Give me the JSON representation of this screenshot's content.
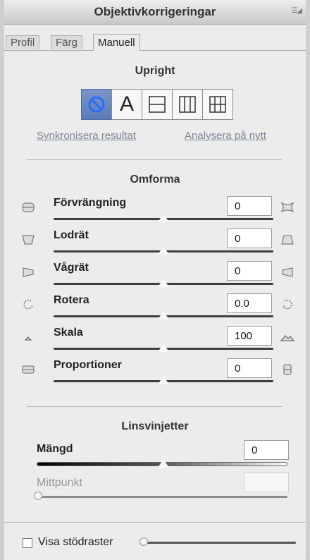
{
  "panel": {
    "title": "Objektivkorrigeringar",
    "menu_icon": "panel-menu-icon"
  },
  "tabs": [
    {
      "label": "Profil",
      "active": false
    },
    {
      "label": "Färg",
      "active": false
    },
    {
      "label": "Manuell",
      "active": true
    }
  ],
  "upright": {
    "title": "Upright",
    "buttons": [
      {
        "name": "off",
        "icon": "prohibit-icon",
        "selected": true
      },
      {
        "name": "auto",
        "icon": "letter-a-icon",
        "label": "A",
        "selected": false
      },
      {
        "name": "level",
        "icon": "horizontal-guide-icon",
        "selected": false
      },
      {
        "name": "vertical",
        "icon": "vertical-guides-icon",
        "selected": false
      },
      {
        "name": "full",
        "icon": "grid-icon",
        "selected": false
      }
    ],
    "sync_link": "Synkronisera resultat",
    "analyze_link": "Analysera på nytt"
  },
  "transform": {
    "title": "Omforma",
    "rows": [
      {
        "label": "Förvrängning",
        "value": "0"
      },
      {
        "label": "Lodrät",
        "value": "0"
      },
      {
        "label": "Vågrät",
        "value": "0"
      },
      {
        "label": "Rotera",
        "value": "0.0"
      },
      {
        "label": "Skala",
        "value": "100"
      },
      {
        "label": "Proportioner",
        "value": "0"
      }
    ]
  },
  "vignette": {
    "title": "Linsvinjetter",
    "amount_label": "Mängd",
    "amount_value": "0",
    "midpoint_label": "Mittpunkt",
    "midpoint_value": ""
  },
  "grid": {
    "label": "Visa stödraster",
    "checked": false
  },
  "colors": {
    "accent": "#5c7bb5",
    "link": "#7b8794"
  }
}
